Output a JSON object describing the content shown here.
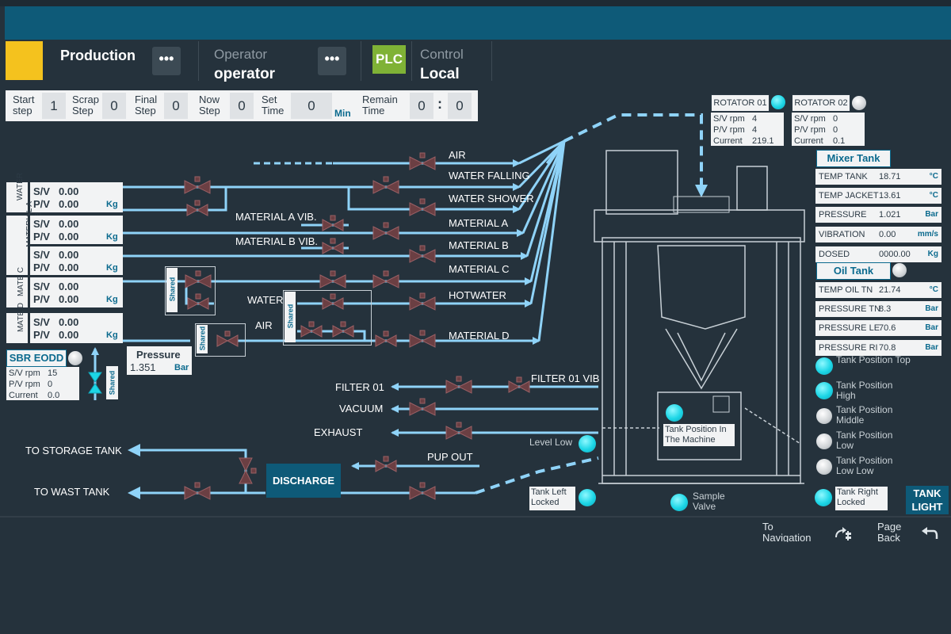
{
  "header": {
    "production_label": "Production",
    "operator_label": "Operator",
    "operator_value": "operator",
    "dots": "•••",
    "plc": "PLC",
    "control_label": "Control",
    "control_value": "Local"
  },
  "steps": {
    "start_label": "Start step",
    "start_value": "1",
    "scrap_label": "Scrap Step",
    "scrap_value": "0",
    "final_label": "Final Step",
    "final_value": "0",
    "now_label": "Now Step",
    "now_value": "0",
    "set_label": "Set Time",
    "set_value": "0",
    "set_unit": "Min",
    "remain_label": "Remain Time",
    "remain_min": "0",
    "remain_sep": ":",
    "remain_sec": "0"
  },
  "feeds": [
    {
      "side": "WATER",
      "sv": "S/V",
      "sv_value": "0.00",
      "pv": "P/V",
      "pv_value": "0.00",
      "unit": "Kg"
    },
    {
      "side": "MATERIAL A AND B",
      "sv": "S/V",
      "sv_value": "0.00",
      "pv": "P/V",
      "pv_value": "0.00",
      "unit": "Kg"
    },
    {
      "side": "",
      "sv": "S/V",
      "sv_value": "0.00",
      "pv": "P/V",
      "pv_value": "0.00",
      "unit": "Kg"
    },
    {
      "side": "MATE C",
      "sv": "S/V",
      "sv_value": "0.00",
      "pv": "P/V",
      "pv_value": "0.00",
      "unit": "Kg"
    },
    {
      "side": "MATE D",
      "sv": "S/V",
      "sv_value": "0.00",
      "pv": "P/V",
      "pv_value": "0.00",
      "unit": "Kg"
    }
  ],
  "sbr": {
    "title": "SBR EODD",
    "sv": "S/V rpm",
    "sv_value": "15",
    "pv": "P/V rpm",
    "pv_value": "0",
    "cur": "Current",
    "cur_value": "0.0"
  },
  "pressure": {
    "label": "Pressure",
    "value": "1.351",
    "unit": "Bar"
  },
  "shared_label": "Shared",
  "flows": {
    "air": "AIR",
    "water_falling": "WATER FALLING",
    "water_shower": "WATER SHOWER",
    "mat_a_vib": "MATERIAL A VIB.",
    "material_a": "MATERIAL A",
    "mat_b_vib": "MATERIAL B VIB.",
    "material_b": "MATERIAL B",
    "material_c": "MATERIAL C",
    "water": "WATER",
    "hotwater": "HOTWATER",
    "air2": "AIR",
    "material_d": "MATERIAL D",
    "filter01": "FILTER 01",
    "filter01_vib": "FILTER 01 VIB",
    "vacuum": "VACUUM",
    "exhaust": "EXHAUST",
    "to_storage": "TO STORAGE TANK",
    "pup_out": "PUP OUT",
    "to_waste": "TO WAST TANK",
    "discharge": "DISCHARGE"
  },
  "rotators": [
    {
      "title": "ROTATOR 01",
      "sv": "S/V rpm",
      "sv_value": "4",
      "pv": "P/V rpm",
      "pv_value": "4",
      "cur": "Current",
      "cur_value": "219.1",
      "status_color": "#1cd6e6"
    },
    {
      "title": "ROTATOR 02",
      "sv": "S/V rpm",
      "sv_value": "0",
      "pv": "P/V rpm",
      "pv_value": "0",
      "cur": "Current",
      "cur_value": "0.1",
      "status_color": "#cfd3d6"
    }
  ],
  "mixer": {
    "title": "Mixer Tank",
    "rows": [
      {
        "name": "TEMP TANK",
        "value": "18.71",
        "unit": "°C"
      },
      {
        "name": "TEMP JACKET",
        "value": "13.61",
        "unit": "°C"
      },
      {
        "name": "PRESSURE",
        "value": "1.021",
        "unit": "Bar"
      },
      {
        "name": "VIBRATION",
        "value": "0.00",
        "unit": "mm/s"
      },
      {
        "name": "DOSED",
        "value": "0000.00",
        "unit": "Kg"
      }
    ]
  },
  "oil": {
    "title": "Oil Tank",
    "rows": [
      {
        "name": "TEMP OIL TN",
        "value": "21.74",
        "unit": "°C"
      },
      {
        "name": "PRESSURE TN",
        "value": "8.3",
        "unit": "Bar"
      },
      {
        "name": "PRESSURE LE",
        "value": "70.6",
        "unit": "Bar"
      },
      {
        "name": "PRESSURE RI",
        "value": "70.8",
        "unit": "Bar"
      }
    ]
  },
  "positions": [
    {
      "label": "Tank Position Top",
      "on": true
    },
    {
      "label": "Tank Position High",
      "on": true
    },
    {
      "label": "Tank Position Middle",
      "on": false
    },
    {
      "label": "Tank Position Low",
      "on": false
    },
    {
      "label": "Tank Position Low Low",
      "on": false
    }
  ],
  "machine": {
    "tank_pos_label": "Tank Position In The Machine",
    "level_low": "Level Low",
    "tank_left": "Tank Left Locked",
    "sample_valve": "Sample Valve",
    "tank_right": "Tank Right Locked",
    "tank_light": "TANK LIGHT"
  },
  "nav": {
    "to_navigation": "To Navigation",
    "page_back": "Page Back"
  },
  "colors": {
    "pipe": "#8fd3f8",
    "valve": "#6b3f43",
    "accent": "#0e5a78"
  }
}
